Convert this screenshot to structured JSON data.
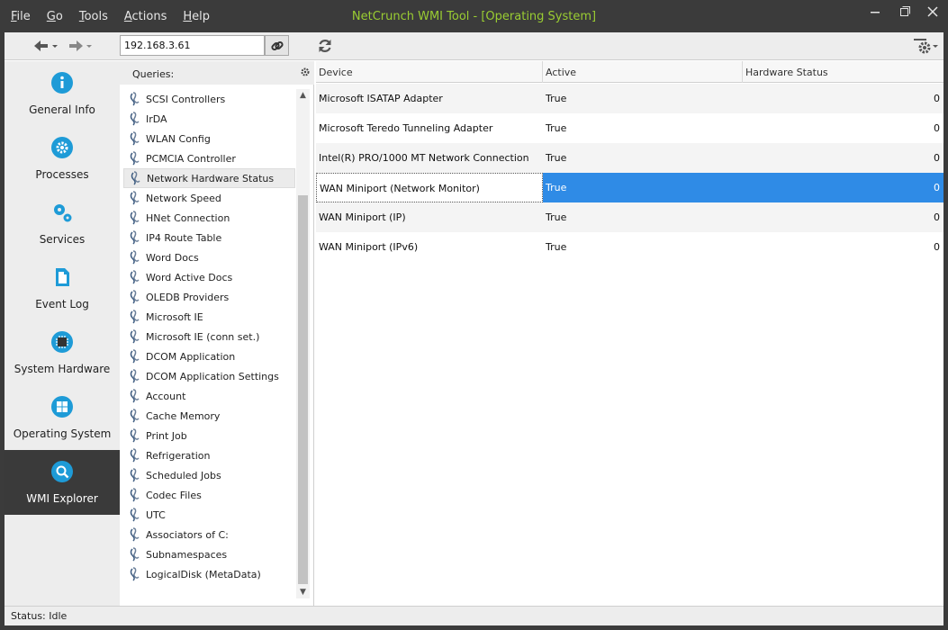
{
  "menu": {
    "items": [
      {
        "first": "F",
        "rest": "ile"
      },
      {
        "first": "G",
        "rest": "o"
      },
      {
        "first": "T",
        "rest": "ools"
      },
      {
        "first": "A",
        "rest": "ctions"
      },
      {
        "first": "H",
        "rest": "elp"
      }
    ]
  },
  "title": "NetCrunch WMI Tool - [Operating System]",
  "toolbar": {
    "address": "192.168.3.61"
  },
  "nav": {
    "items": [
      {
        "label": "General Info",
        "icon": "info-icon"
      },
      {
        "label": "Processes",
        "icon": "gear-icon"
      },
      {
        "label": "Services",
        "icon": "gears-icon"
      },
      {
        "label": "Event Log",
        "icon": "document-icon"
      },
      {
        "label": "System Hardware",
        "icon": "chip-icon"
      },
      {
        "label": "Operating System",
        "icon": "windows-icon"
      },
      {
        "label": "WMI Explorer",
        "icon": "search-icon",
        "active": true
      }
    ]
  },
  "queries": {
    "header": "Queries:",
    "items": [
      "SCSI Controllers",
      "IrDA",
      "WLAN Config",
      "PCMCIA Controller",
      "Network Hardware Status",
      "Network Speed",
      "HNet Connection",
      "IP4 Route Table",
      "Word Docs",
      "Word Active Docs",
      "OLEDB Providers",
      "Microsoft IE",
      "Microsoft IE (conn set.)",
      "DCOM Application",
      "DCOM Application Settings",
      "Account",
      "Cache Memory",
      "Print Job",
      "Refrigeration",
      "Scheduled Jobs",
      "Codec Files",
      "UTC",
      "Associators of C:",
      "Subnamespaces",
      "LogicalDisk (MetaData)"
    ],
    "selected": "Network Hardware Status"
  },
  "grid": {
    "columns": [
      "Device",
      "Active",
      "Hardware Status"
    ],
    "rows": [
      {
        "device": "Microsoft ISATAP Adapter",
        "active": "True",
        "hw": "0"
      },
      {
        "device": "Microsoft Teredo Tunneling Adapter",
        "active": "True",
        "hw": "0"
      },
      {
        "device": "Intel(R) PRO/1000 MT Network Connection",
        "active": "True",
        "hw": "0"
      },
      {
        "device": "WAN Miniport (Network Monitor)",
        "active": "True",
        "hw": "0",
        "selected": true
      },
      {
        "device": "WAN Miniport (IP)",
        "active": "True",
        "hw": "0"
      },
      {
        "device": "WAN Miniport (IPv6)",
        "active": "True",
        "hw": "0"
      }
    ]
  },
  "status": "Status: Idle",
  "colors": {
    "accent": "#1e9bd7",
    "title_text": "#9acd32",
    "selection": "#2f8be6",
    "chrome_dark": "#3b3b3b"
  }
}
